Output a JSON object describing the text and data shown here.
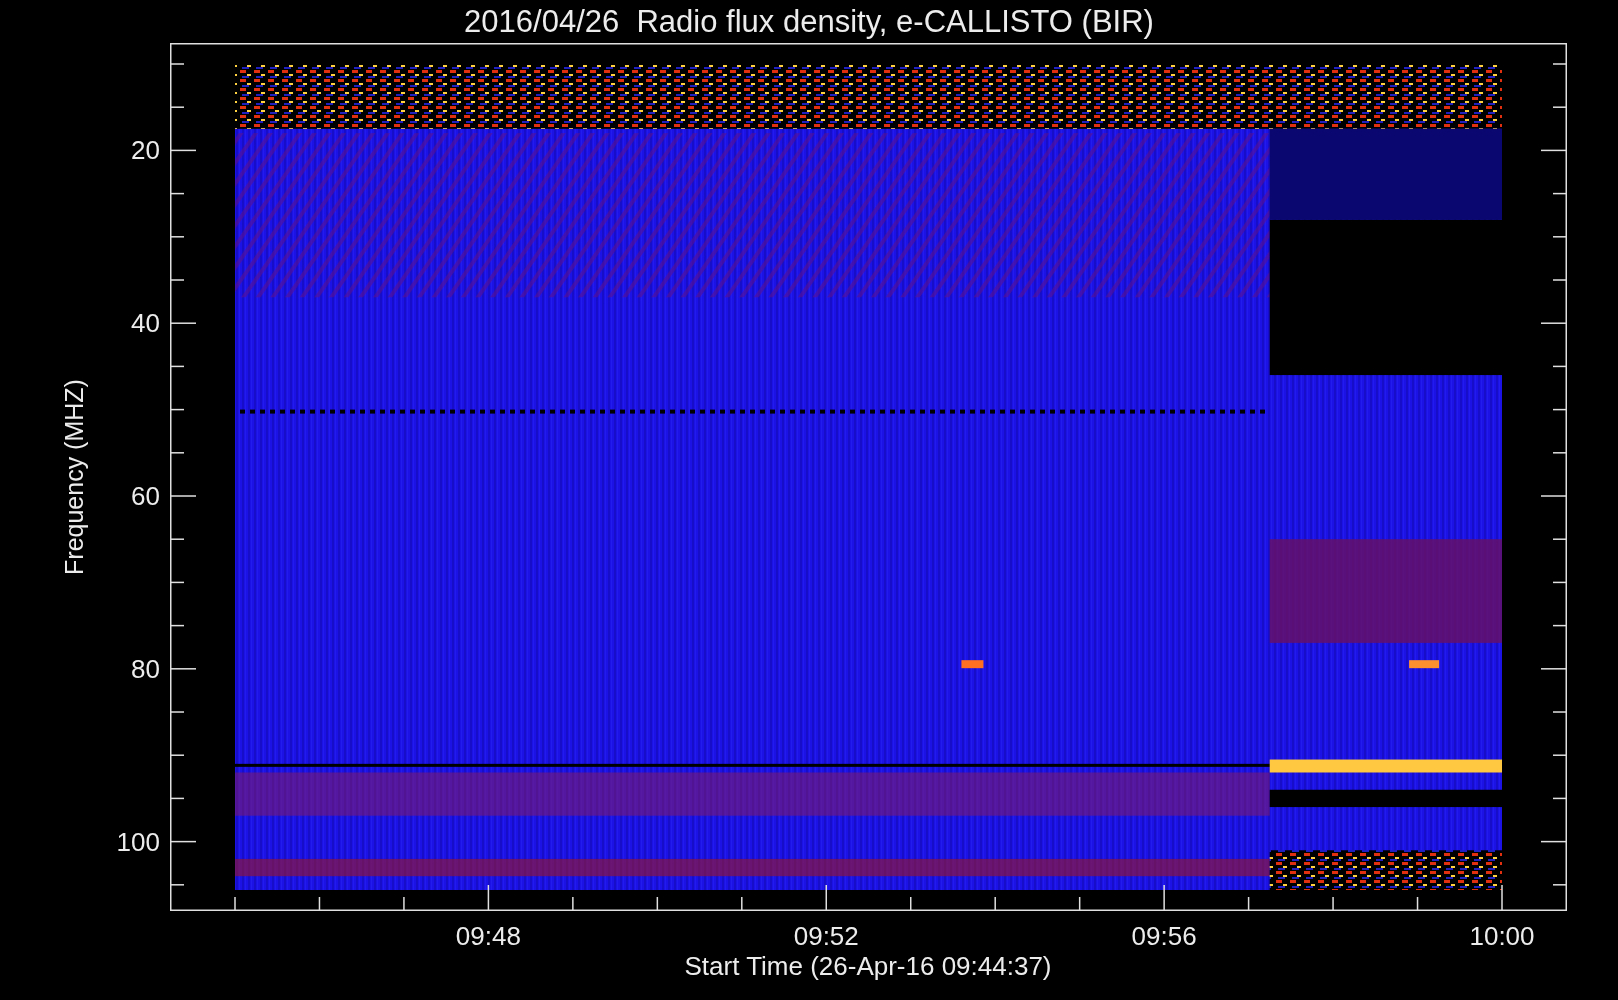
{
  "title": "2016/04/26  Radio flux density, e-CALLISTO (BIR)",
  "y_axis": {
    "label": "Frequency (MHZ)",
    "ticks": [
      "20",
      "40",
      "60",
      "80",
      "100"
    ]
  },
  "x_axis": {
    "label": "Start Time (26-Apr-16 09:44:37)",
    "ticks": [
      "09:48",
      "09:52",
      "09:56",
      "10:00"
    ]
  }
}
